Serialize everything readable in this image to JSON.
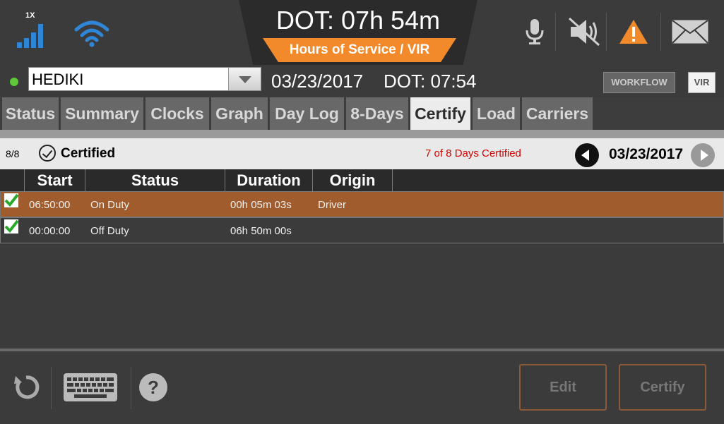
{
  "header": {
    "signal_label": "1X",
    "dot_time": "DOT: 07h 54m",
    "subtitle": "Hours of Service / VIR",
    "icons": [
      "signal-icon",
      "wifi-icon",
      "microphone-icon",
      "sound-muted-icon",
      "warning-icon",
      "mail-icon"
    ],
    "accent_color": "#f28a2c"
  },
  "driver": {
    "name": "HEDIKI",
    "date": "03/23/2017",
    "dot": "DOT: 07:54",
    "workflow_label": "WORKFLOW",
    "vir_label": "VIR",
    "status_color": "#5fc83a"
  },
  "tabs": [
    {
      "label": "Status"
    },
    {
      "label": "Summary"
    },
    {
      "label": "Clocks"
    },
    {
      "label": "Graph"
    },
    {
      "label": "Day Log"
    },
    {
      "label": "8-Days"
    },
    {
      "label": "Certify"
    },
    {
      "label": "Load"
    },
    {
      "label": "Carriers"
    }
  ],
  "active_tab": "Certify",
  "cert": {
    "count": "8/8",
    "label": "Certified",
    "days_text": "7 of 8 Days Certified",
    "date": "03/23/2017"
  },
  "table": {
    "columns": [
      "Start",
      "Status",
      "Duration",
      "Origin"
    ],
    "rows": [
      {
        "start": "06:50:00",
        "status": "On Duty",
        "duration": "00h 05m 03s",
        "origin": "Driver",
        "checked": true
      },
      {
        "start": "00:00:00",
        "status": "Off Duty",
        "duration": "06h 50m 00s",
        "origin": "",
        "checked": true
      }
    ],
    "selected_row_color": "#a05c2c"
  },
  "footer": {
    "edit_label": "Edit",
    "certify_label": "Certify",
    "icons": [
      "refresh-icon",
      "keyboard-icon",
      "help-icon"
    ]
  }
}
